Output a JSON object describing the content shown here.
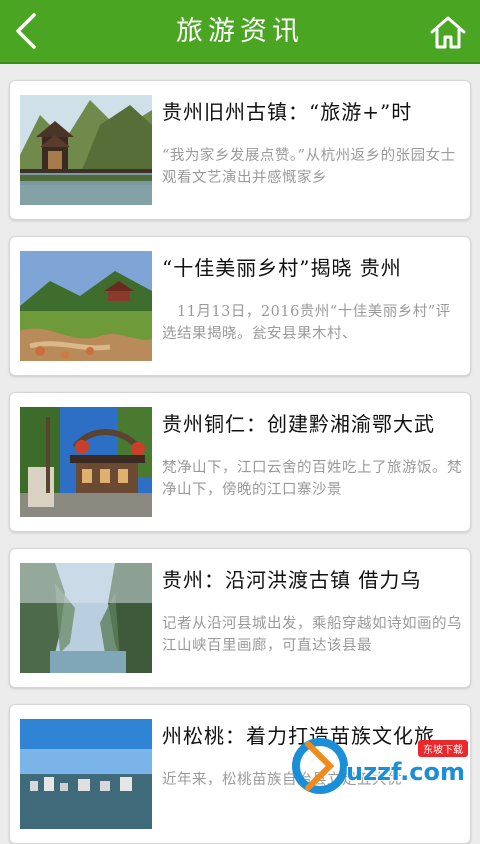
{
  "header": {
    "title": "旅游资讯",
    "back_icon": "chevron-left-icon",
    "home_icon": "home-icon",
    "accent": "#4aa622"
  },
  "articles": [
    {
      "title": "贵州旧州古镇：“旅游+”时",
      "summary": "“我为家乡发展点赞。”从杭州返乡的张园女士观看文艺演出并感慨家乡",
      "image": "pagoda-lake-photo"
    },
    {
      "title": "“十佳美丽乡村”揭晓 贵州",
      "summary": "　11月13日，2016贵州“十佳美丽乡村”评选结果揭晓。瓮安县果木村、",
      "image": "village-stream-photo"
    },
    {
      "title": "贵州铜仁：创建黔湘渝鄂大武",
      "summary": "梵净山下，江口云舍的百姓吃上了旅游饭。梵净山下，傍晚的江口寨沙景",
      "image": "village-gate-photo"
    },
    {
      "title": "贵州：沿河洪渡古镇 借力乌",
      "summary": "记者从沿河县城出发，乘船穿越如诗如画的乌江山峡百里画廊，可直达该县最",
      "image": "river-gorge-photo"
    },
    {
      "title": "州松桃：着力打造苗族文化旅",
      "summary": "近年来，松桃苗族自治县立足五大优",
      "image": "aerial-town-photo"
    }
  ],
  "watermark": {
    "text": "uzzf.com",
    "badge": "东坡下载"
  }
}
